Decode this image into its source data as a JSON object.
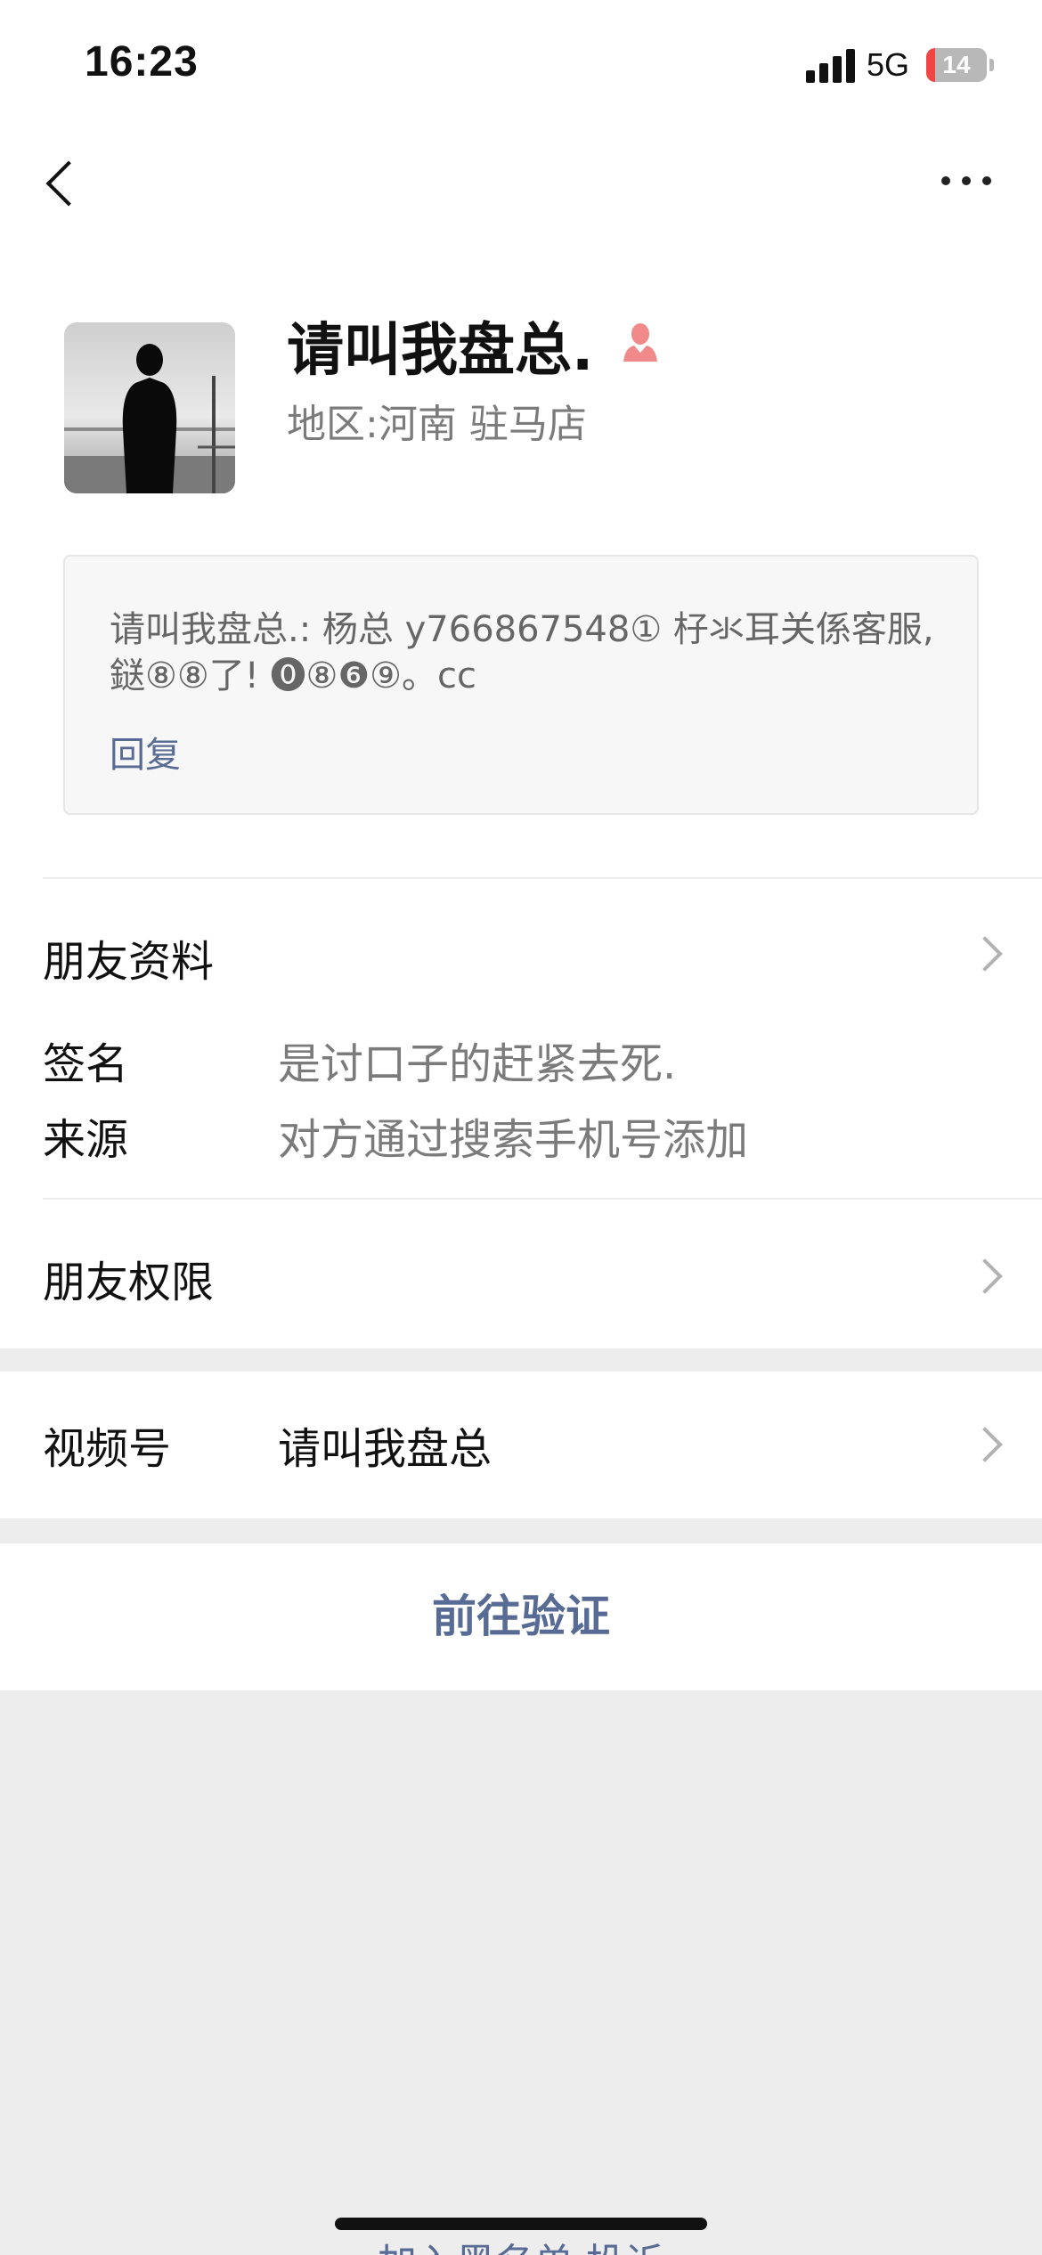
{
  "status_bar": {
    "time": "16:23",
    "network": "5G",
    "battery": "14",
    "battery_level": 0.14
  },
  "nav": {
    "back_icon": "back-chevron-icon",
    "more_icon": "more-dots-icon"
  },
  "profile": {
    "name": "请叫我盘总.",
    "gender_icon": "female-icon",
    "region_label": "地区:",
    "region_value": "河南 驻马店"
  },
  "moment": {
    "text": "请叫我盘总.: 杨总 y766867548① 杍氺耳关係客服,鎹⑧⑧了! ⓿⑧❻⑨。cc",
    "reply_label": "回复"
  },
  "friend_info": {
    "title": "朋友资料",
    "signature_label": "签名",
    "signature_value": "是讨口子的赶紧去死.",
    "source_label": "来源",
    "source_value": "对方通过搜索手机号添加"
  },
  "permissions": {
    "title": "朋友权限"
  },
  "channels": {
    "label": "视频号",
    "value": "请叫我盘总"
  },
  "verify": {
    "label": "前往验证"
  },
  "bottom": {
    "link_text": "加入黑名单 投诉"
  },
  "colors": {
    "link": "#576b95",
    "secondary": "#7b7b7b",
    "background": "#ededed"
  }
}
